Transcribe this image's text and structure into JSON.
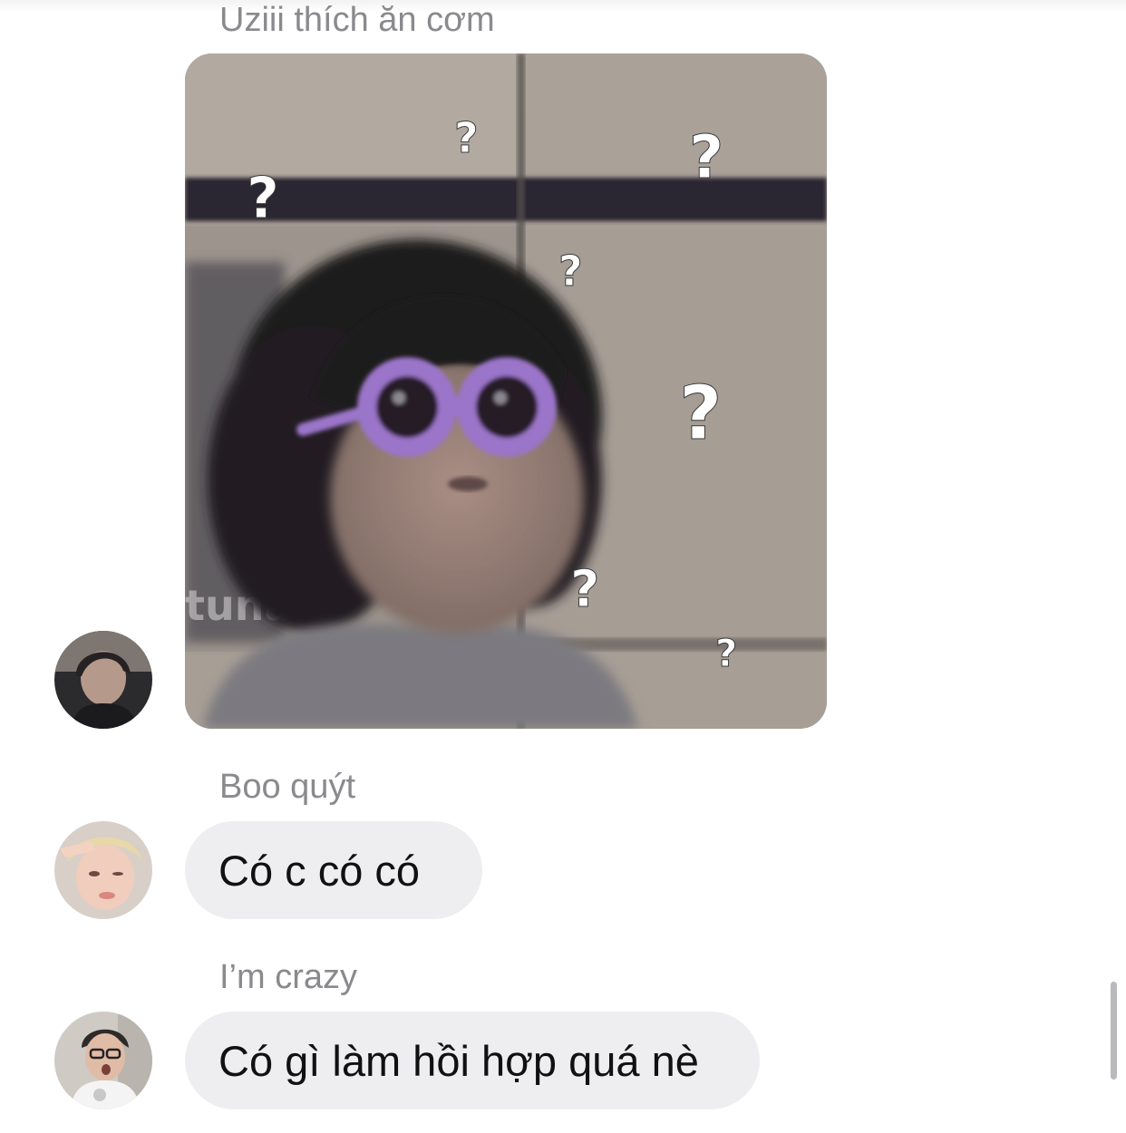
{
  "messages": [
    {
      "sender": "Uziii thích ăn cơm",
      "type": "image",
      "image": {
        "description_icon": "confused-child-meme-image",
        "watermark": "tuna",
        "overlay_glyph": "?"
      },
      "avatar_icon": "avatar-uziii"
    },
    {
      "sender": "Boo quýt",
      "type": "text",
      "text": "Có c có có",
      "avatar_icon": "avatar-boo-quyt"
    },
    {
      "sender": "I’m crazy",
      "type": "text",
      "text": "Có gì làm hồi hợp quá nè",
      "avatar_icon": "avatar-im-crazy"
    }
  ],
  "colors": {
    "bubble_bg": "#eeeef1",
    "sender_name": "#8a8a8e",
    "message_text": "#111111",
    "accent_glasses": "#9b74c9"
  }
}
